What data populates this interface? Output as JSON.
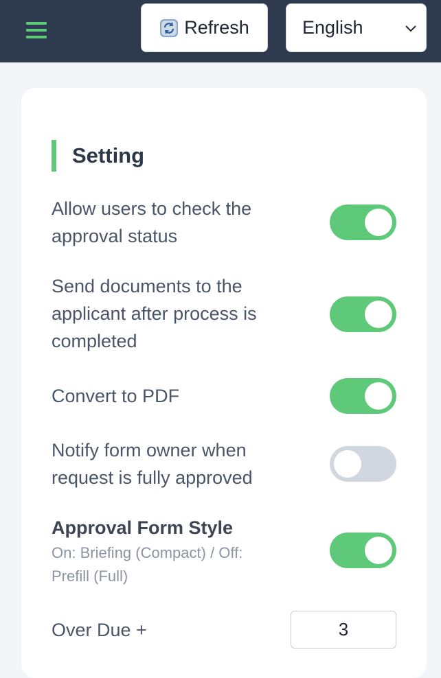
{
  "header": {
    "refresh_label": "Refresh",
    "language": "English",
    "menu_icon": "hamburger-menu-icon",
    "refresh_icon": "refresh-icon",
    "accent_color": "#5ec978",
    "bar_color": "#2e3b4e"
  },
  "settings": {
    "title": "Setting",
    "items": [
      {
        "label_line1": "Allow users to check the",
        "label_line2": "approval status",
        "enabled": true
      },
      {
        "label_line1": "Send documents to the",
        "label_line2": "applicant after process is",
        "label_line3": "completed",
        "enabled": true
      },
      {
        "label_line1": "Convert to PDF",
        "enabled": true
      },
      {
        "label_line1": "Notify form owner when",
        "label_line2": "request is fully approved",
        "enabled": false
      },
      {
        "label_line1": "Approval Form Style",
        "sub_line1": "On: Briefing (Compact) / Off:",
        "sub_line2": "Prefill (Full)",
        "enabled": true
      }
    ],
    "overdue": {
      "label": "Over Due +",
      "value": "3"
    }
  }
}
